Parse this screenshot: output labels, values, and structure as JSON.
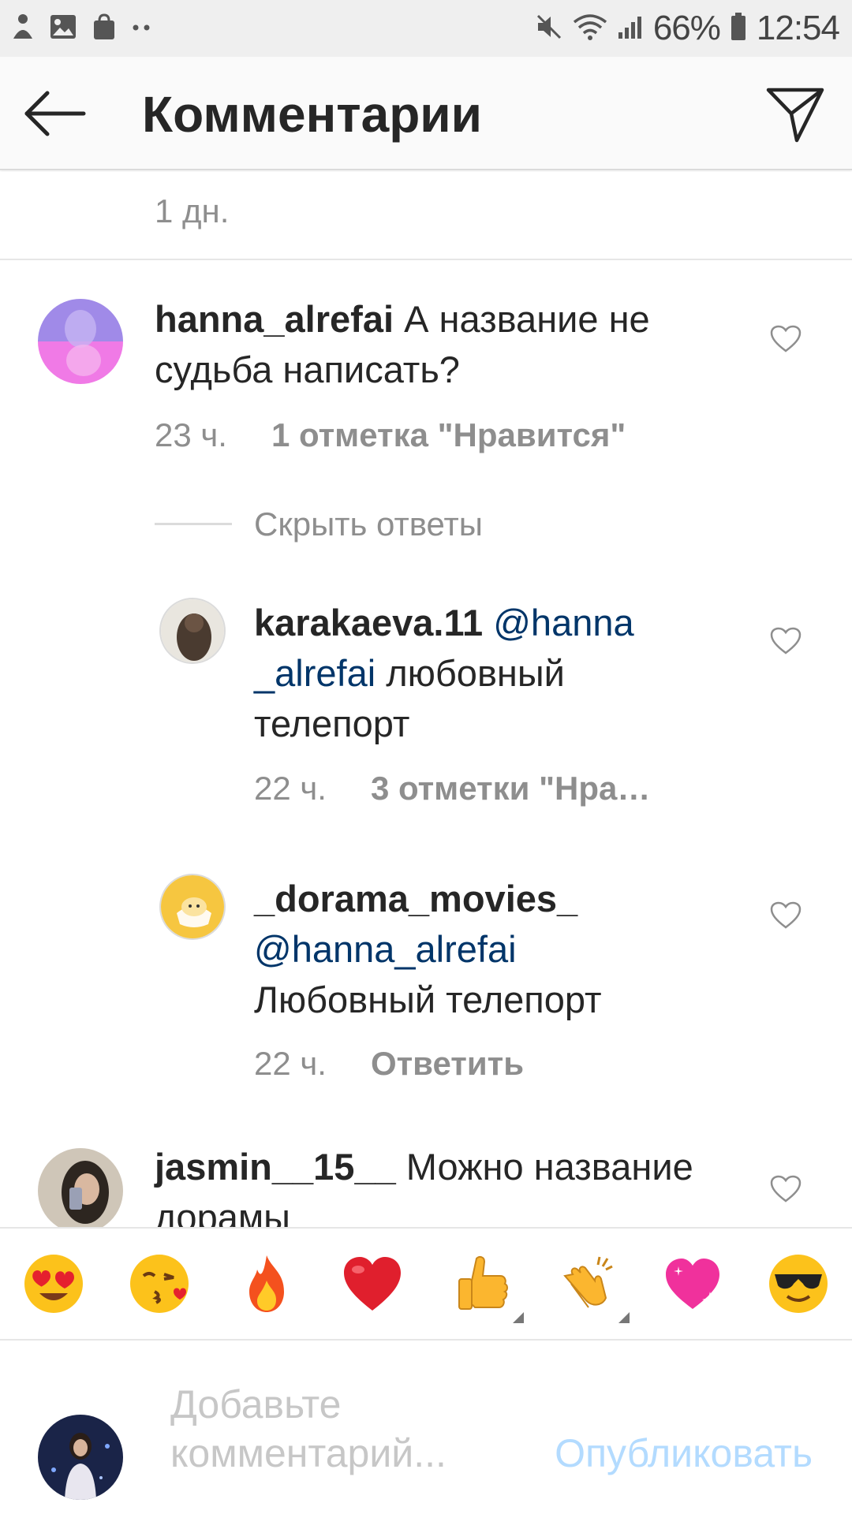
{
  "status_bar": {
    "battery": "66%",
    "time": "12:54",
    "left_icons": [
      "app-notification-icon",
      "image-icon",
      "shopping-bag-icon",
      "more-dots-icon"
    ],
    "right_icons": [
      "mute-icon",
      "wifi-icon",
      "signal-icon",
      "battery-icon"
    ]
  },
  "header": {
    "title": "Комментарии",
    "back_icon": "arrow-left-icon",
    "action_icon": "paper-plane-icon"
  },
  "previous_comment": {
    "time": "1 дн."
  },
  "comments": [
    {
      "username": "hanna_alrefai",
      "text": " А название не судьба  написать?",
      "time": "23 ч.",
      "likes": "1 отметка \"Нравится\"",
      "is_reply": false
    },
    {
      "username": "karakaeva.11",
      "mention": " @hanna _alrefai",
      "text": " любовный телепорт",
      "time": "22 ч.",
      "likes": "3 отметки \"Нра…",
      "is_reply": true
    },
    {
      "username": "_dorama_movies_",
      "mention": " @hanna_alrefai",
      "text": " Любовный телепорт",
      "time": "22 ч.",
      "reply": "Ответить",
      "is_reply": true
    },
    {
      "username": "jasmin__15__",
      "text": " Можно название дорамы",
      "is_reply": false
    }
  ],
  "hide_replies": "Скрыть ответы",
  "emoji_bar": [
    "😍",
    "😘",
    "🔥",
    "❤️",
    "👍",
    "👏",
    "💖",
    "😎"
  ],
  "input": {
    "placeholder": "Добавьте комментарий...",
    "post_button": "Опубликовать"
  },
  "colors": {
    "mention": "#003569",
    "secondary_text": "#8e8e8e",
    "post_disabled": "#b3dbff"
  }
}
